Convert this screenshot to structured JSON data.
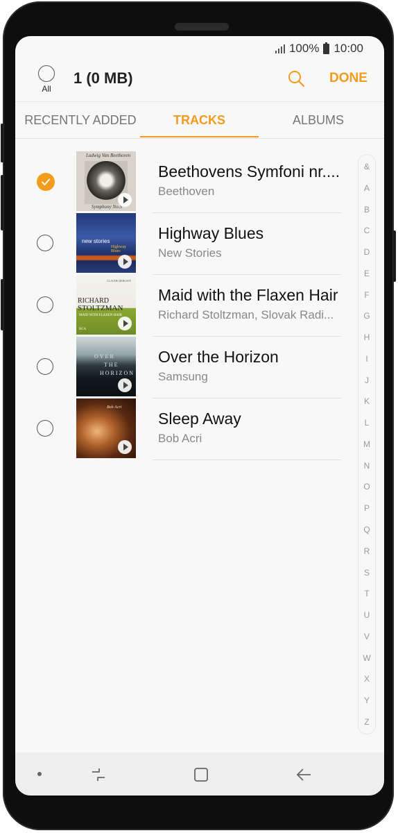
{
  "status_bar": {
    "signal_icon": "signal-icon",
    "battery_level": "100%",
    "time": "10:00"
  },
  "header": {
    "select_all_label": "All",
    "selection_count": "1 (0 MB)",
    "done_label": "DONE",
    "accent_color": "#f29b1c"
  },
  "tabs": [
    {
      "label": "RECENTLY ADDED",
      "active": false
    },
    {
      "label": "TRACKS",
      "active": true
    },
    {
      "label": "ALBUMS",
      "active": false
    }
  ],
  "tracks": [
    {
      "title": "Beethovens Symfoni nr....",
      "artist": "Beethoven",
      "selected": true,
      "art_text": [
        "Ludwig Van Beethoven",
        "Symphony No.5"
      ]
    },
    {
      "title": "Highway Blues",
      "artist": "New Stories",
      "selected": false,
      "art_text": [
        "new stories",
        "Highway Blues"
      ]
    },
    {
      "title": "Maid with the Flaxen Hair",
      "artist": "Richard Stoltzman, Slovak Radi...",
      "selected": false,
      "art_text": [
        "CLAUDE DEBUSSY",
        "RICHARD",
        "STOLTZMAN",
        "MAID WITH FLAXEN HAIR",
        "RCA"
      ]
    },
    {
      "title": "Over the Horizon",
      "artist": "Samsung",
      "selected": false,
      "art_text": [
        "OVER",
        "THE",
        "HORIZON"
      ]
    },
    {
      "title": "Sleep Away",
      "artist": "Bob Acri",
      "selected": false,
      "art_text": [
        "Bob Acri"
      ]
    }
  ],
  "index_letters": [
    "&",
    "A",
    "B",
    "C",
    "D",
    "E",
    "F",
    "G",
    "H",
    "I",
    "J",
    "K",
    "L",
    "M",
    "N",
    "O",
    "P",
    "Q",
    "R",
    "S",
    "T",
    "U",
    "V",
    "W",
    "X",
    "Y",
    "Z"
  ],
  "navbar": {
    "items": [
      "recent-apps-icon",
      "home-icon",
      "back-icon"
    ]
  }
}
